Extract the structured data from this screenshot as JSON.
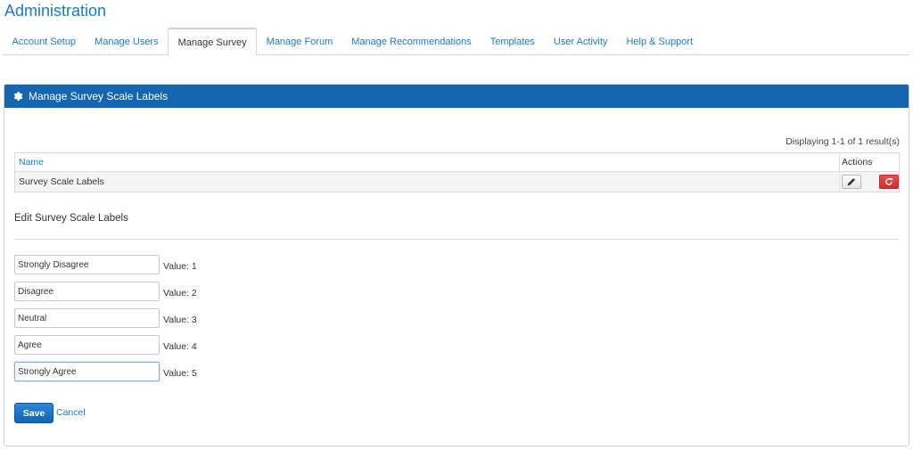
{
  "page": {
    "title": "Administration"
  },
  "tabs": [
    {
      "label": "Account Setup"
    },
    {
      "label": "Manage Users"
    },
    {
      "label": "Manage Survey",
      "active": true
    },
    {
      "label": "Manage Forum"
    },
    {
      "label": "Manage Recommendations"
    },
    {
      "label": "Templates"
    },
    {
      "label": "User Activity"
    },
    {
      "label": "Help & Support"
    }
  ],
  "panel": {
    "title": "Manage Survey Scale Labels",
    "icon": "gear-icon",
    "header_color": "#1565b0"
  },
  "grid": {
    "summary": "Displaying 1-1 of 1 result(s)",
    "columns": {
      "name": "Name",
      "actions": "Actions"
    },
    "rows": [
      {
        "name": "Survey Scale Labels",
        "actions": [
          "pencil-icon",
          "refresh-icon"
        ]
      }
    ]
  },
  "edit_form": {
    "title": "Edit Survey Scale Labels",
    "fields": [
      {
        "value": "Strongly Disagree",
        "value_label": "Value: 1"
      },
      {
        "value": "Disagree",
        "value_label": "Value: 2"
      },
      {
        "value": "Neutral",
        "value_label": "Value: 3"
      },
      {
        "value": "Agree",
        "value_label": "Value: 4"
      },
      {
        "value": "Strongly Agree",
        "value_label": "Value: 5",
        "focused": true
      }
    ],
    "save_label": "Save",
    "cancel_label": "Cancel"
  },
  "colors": {
    "link": "#1b7ac1",
    "primary": "#1565b0",
    "danger": "#cf2f2c"
  }
}
